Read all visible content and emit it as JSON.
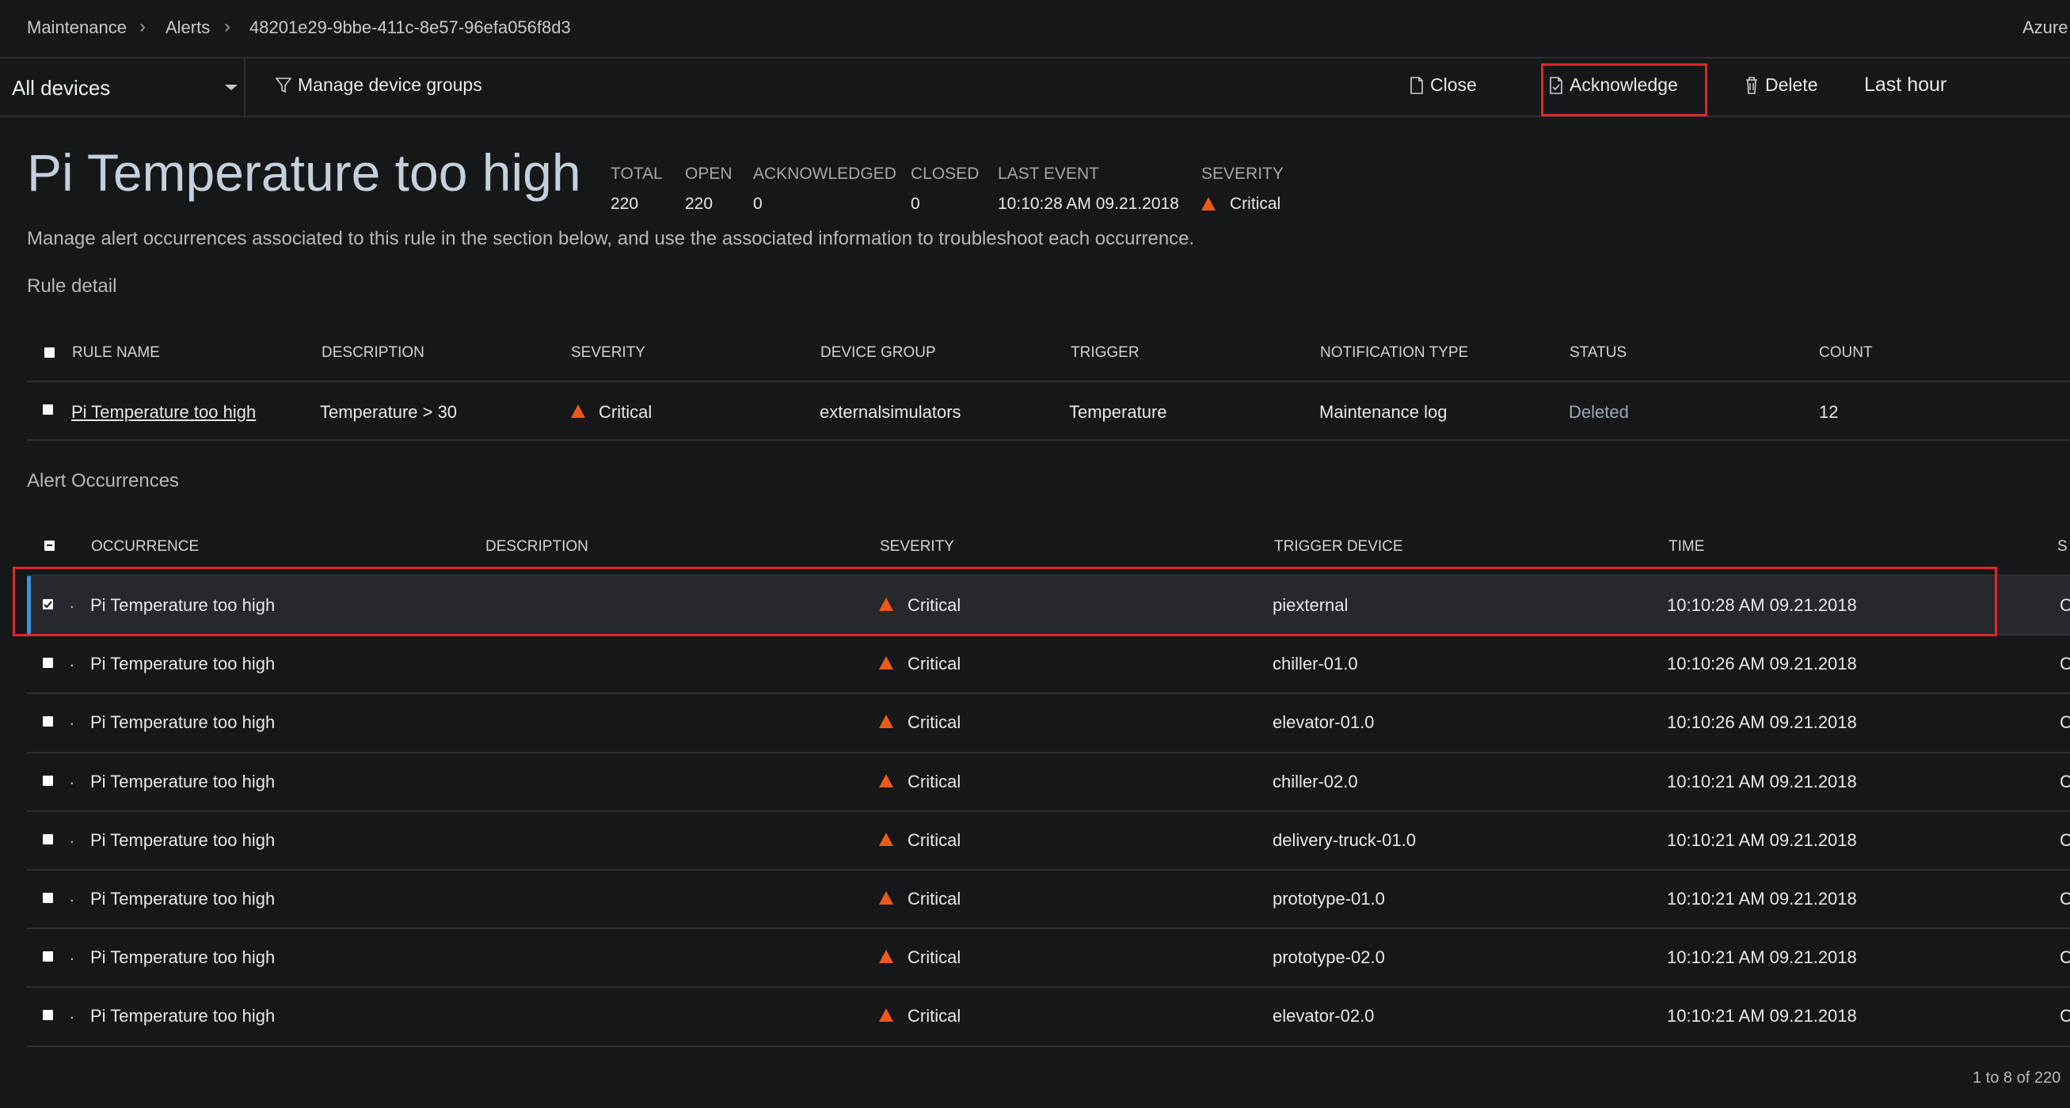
{
  "breadcrumb": {
    "items": [
      "Maintenance",
      "Alerts",
      "48201e29-9bbe-411c-8e57-96efa056f8d3"
    ],
    "brand": "Azure"
  },
  "toolbar": {
    "device_filter": "All devices",
    "manage_groups": "Manage device groups",
    "close": "Close",
    "acknowledge": "Acknowledge",
    "delete": "Delete",
    "time_range": "Last hour"
  },
  "alert": {
    "title": "Pi Temperature too high",
    "stats": [
      {
        "label": "TOTAL",
        "value": "220"
      },
      {
        "label": "OPEN",
        "value": "220"
      },
      {
        "label": "ACKNOWLEDGED",
        "value": "0"
      },
      {
        "label": "CLOSED",
        "value": "0"
      },
      {
        "label": "LAST EVENT",
        "value": "10:10:28 AM 09.21.2018"
      },
      {
        "label": "SEVERITY",
        "value": "Critical"
      }
    ],
    "description": "Manage alert occurrences associated to this rule in the section below, and use the associated information to troubleshoot each occurrence."
  },
  "rule_detail": {
    "section_title": "Rule detail",
    "headers": [
      "RULE NAME",
      "DESCRIPTION",
      "SEVERITY",
      "DEVICE GROUP",
      "TRIGGER",
      "NOTIFICATION TYPE",
      "STATUS",
      "COUNT"
    ],
    "row": {
      "rule_name": "Pi Temperature too high",
      "description": "Temperature > 30",
      "severity": "Critical",
      "device_group": "externalsimulators",
      "trigger": "Temperature",
      "notification_type": "Maintenance log",
      "status": "Deleted",
      "count": "12"
    }
  },
  "occurrences": {
    "section_title": "Alert Occurrences",
    "headers": [
      "OCCURRENCE",
      "DESCRIPTION",
      "SEVERITY",
      "TRIGGER DEVICE",
      "TIME",
      "S"
    ],
    "rows": [
      {
        "occurrence": "Pi Temperature too high",
        "severity": "Critical",
        "device": "piexternal",
        "time": "10:10:28 AM 09.21.2018",
        "status": "C",
        "checked": true
      },
      {
        "occurrence": "Pi Temperature too high",
        "severity": "Critical",
        "device": "chiller-01.0",
        "time": "10:10:26 AM 09.21.2018",
        "status": "C",
        "checked": false
      },
      {
        "occurrence": "Pi Temperature too high",
        "severity": "Critical",
        "device": "elevator-01.0",
        "time": "10:10:26 AM 09.21.2018",
        "status": "C",
        "checked": false
      },
      {
        "occurrence": "Pi Temperature too high",
        "severity": "Critical",
        "device": "chiller-02.0",
        "time": "10:10:21 AM 09.21.2018",
        "status": "C",
        "checked": false
      },
      {
        "occurrence": "Pi Temperature too high",
        "severity": "Critical",
        "device": "delivery-truck-01.0",
        "time": "10:10:21 AM 09.21.2018",
        "status": "C",
        "checked": false
      },
      {
        "occurrence": "Pi Temperature too high",
        "severity": "Critical",
        "device": "prototype-01.0",
        "time": "10:10:21 AM 09.21.2018",
        "status": "C",
        "checked": false
      },
      {
        "occurrence": "Pi Temperature too high",
        "severity": "Critical",
        "device": "prototype-02.0",
        "time": "10:10:21 AM 09.21.2018",
        "status": "C",
        "checked": false
      },
      {
        "occurrence": "Pi Temperature too high",
        "severity": "Critical",
        "device": "elevator-02.0",
        "time": "10:10:21 AM 09.21.2018",
        "status": "C",
        "checked": false
      }
    ],
    "pagination": "1 to 8 of 220"
  },
  "colors": {
    "critical": "#ea5a1a",
    "highlight_border": "#e0262d",
    "selected_accent": "#3d8fe0"
  }
}
